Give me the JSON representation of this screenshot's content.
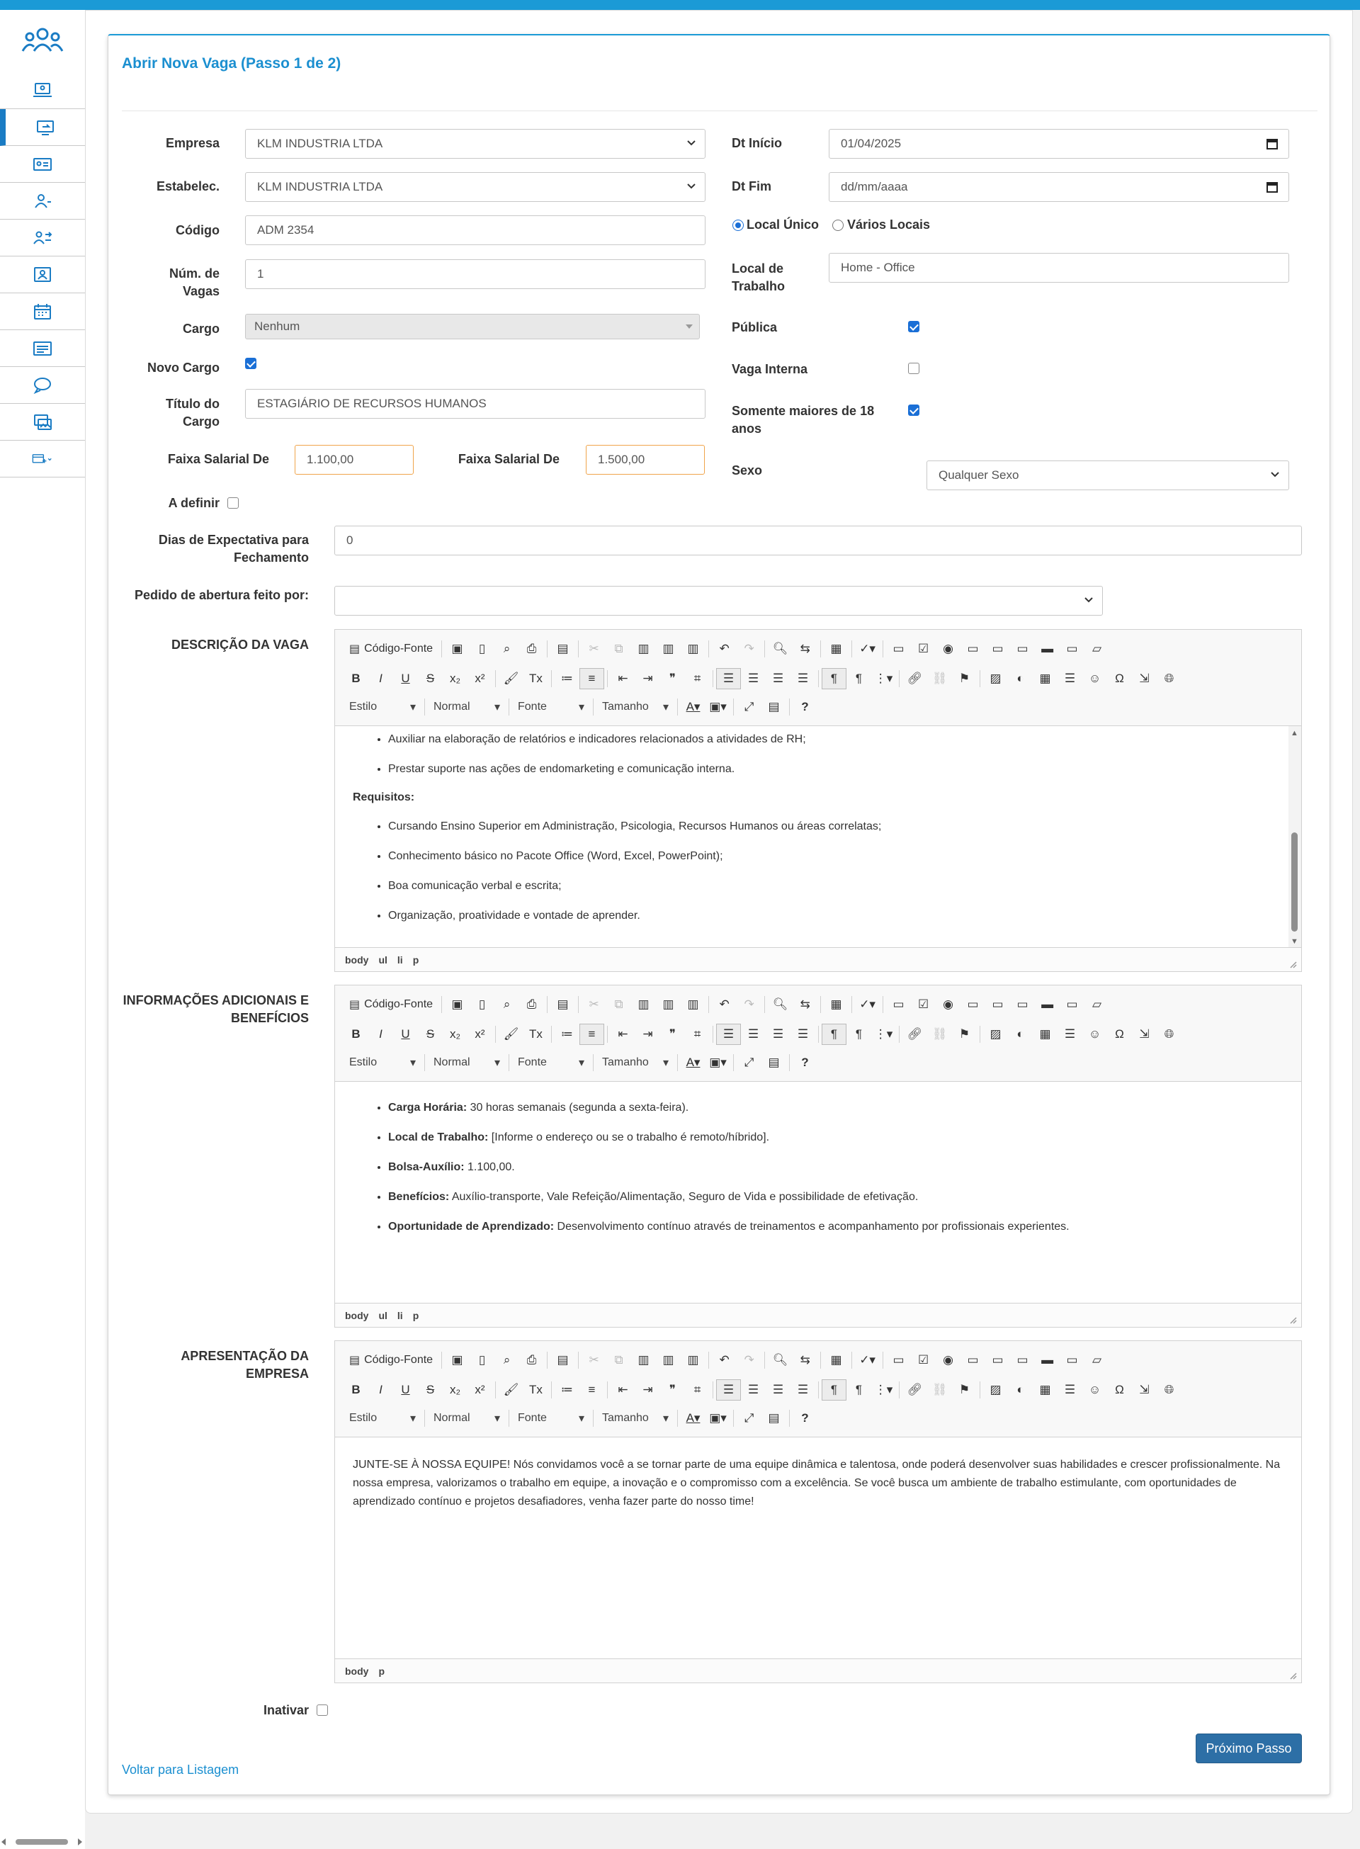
{
  "page": {
    "title": "Abrir Nova Vaga (Passo 1 de 2)"
  },
  "sidebar": {
    "items": [
      {
        "icon": "laptop-user-icon"
      },
      {
        "icon": "monitor-arrow-icon"
      },
      {
        "icon": "id-card-icon"
      },
      {
        "icon": "user-list-icon"
      },
      {
        "icon": "user-swap-icon"
      },
      {
        "icon": "user-frame-icon"
      },
      {
        "icon": "calendar-icon"
      },
      {
        "icon": "list-card-icon"
      },
      {
        "icon": "chat-icon"
      },
      {
        "icon": "image-swap-icon"
      },
      {
        "icon": "card-add-icon"
      }
    ]
  },
  "form": {
    "empresa": {
      "label": "Empresa",
      "value": "KLM INDUSTRIA LTDA"
    },
    "estabelec": {
      "label": "Estabelec.",
      "value": "KLM INDUSTRIA LTDA"
    },
    "codigo": {
      "label": "Código",
      "value": "ADM 2354"
    },
    "num_vagas": {
      "label": "Núm. de Vagas",
      "value": "1"
    },
    "cargo": {
      "label": "Cargo",
      "value": "Nenhum"
    },
    "novo_cargo": {
      "label": "Novo Cargo",
      "checked": true
    },
    "titulo_cargo": {
      "label": "Título do Cargo",
      "value": "ESTAGIÁRIO DE RECURSOS HUMANOS"
    },
    "faixa_de": {
      "label": "Faixa Salarial De",
      "value": "1.100,00"
    },
    "faixa_ate": {
      "label": "Faixa Salarial De",
      "value": "1.500,00"
    },
    "a_definir": {
      "label": "A definir",
      "checked": false
    },
    "dt_inicio": {
      "label": "Dt Início",
      "value": "01/04/2025"
    },
    "dt_fim": {
      "label": "Dt Fim",
      "value": "dd/mm/aaaa"
    },
    "local_unico": {
      "label": "Local Único",
      "checked": true
    },
    "varios_locais": {
      "label": "Vários Locais",
      "checked": false
    },
    "local_trabalho": {
      "label": "Local de Trabalho",
      "value": "Home - Office"
    },
    "publica": {
      "label": "Pública",
      "checked": true
    },
    "vaga_interna": {
      "label": "Vaga Interna",
      "checked": false
    },
    "maiores_18": {
      "label": "Somente maiores de 18 anos",
      "checked": true
    },
    "sexo": {
      "label": "Sexo",
      "value": "Qualquer Sexo"
    },
    "dias_expectativa": {
      "label": "Dias de Expectativa para Fechamento",
      "value": "0"
    },
    "pedido_abertura": {
      "label": "Pedido de abertura feito por:",
      "value": ""
    },
    "inativar": {
      "label": "Inativar",
      "checked": false
    }
  },
  "editor_toolbar": {
    "source_label": "Código-Fonte",
    "style_combo": "Estilo",
    "format_combo": "Normal",
    "font_combo": "Fonte",
    "size_combo": "Tamanho"
  },
  "descricao": {
    "label": "DESCRIÇÃO DA VAGA",
    "items_top": [
      "Auxiliar na elaboração de relatórios e indicadores relacionados a atividades de RH;",
      "Prestar suporte nas ações de endomarketing e comunicação interna."
    ],
    "requisitos_heading": "Requisitos:",
    "requisitos": [
      "Cursando Ensino Superior em Administração, Psicologia, Recursos Humanos ou áreas correlatas;",
      "Conhecimento básico no Pacote Office (Word, Excel, PowerPoint);",
      "Boa comunicação verbal e escrita;",
      "Organização, proatividade e vontade de aprender."
    ],
    "path": [
      "body",
      "ul",
      "li",
      "p"
    ]
  },
  "info": {
    "label": "INFORMAÇÕES ADICIONAIS E BENEFÍCIOS",
    "items": [
      {
        "bold": "Carga Horária:",
        "text": " 30 horas semanais (segunda a sexta-feira)."
      },
      {
        "bold": "Local de Trabalho:",
        "text": " [Informe o endereço ou se o trabalho é remoto/híbrido]."
      },
      {
        "bold": "Bolsa-Auxílio:",
        "text": " 1.100,00."
      },
      {
        "bold": "Benefícios:",
        "text": " Auxílio-transporte, Vale Refeição/Alimentação, Seguro de Vida e possibilidade de efetivação."
      },
      {
        "bold": "Oportunidade de Aprendizado:",
        "text": " Desenvolvimento contínuo através de treinamentos e acompanhamento por profissionais experientes."
      }
    ],
    "path": [
      "body",
      "ul",
      "li",
      "p"
    ]
  },
  "apresentacao": {
    "label": "APRESENTAÇÃO DA EMPRESA",
    "text": "JUNTE-SE À NOSSA EQUIPE! Nós convidamos você a se tornar parte de uma equipe dinâmica e talentosa, onde poderá desenvolver suas habilidades e crescer profissionalmente. Na nossa empresa, valorizamos o trabalho em equipe, a inovação e o compromisso com a excelência. Se você busca um ambiente de trabalho estimulante, com oportunidades de aprendizado contínuo e projetos desafiadores, venha fazer parte do nosso time!",
    "path": [
      "body",
      "p"
    ]
  },
  "actions": {
    "next_button": "Próximo Passo",
    "back_link": "Voltar para Listagem"
  },
  "colors": {
    "accent": "#1b9ad6",
    "link": "#1b8fd0",
    "primary_button": "#2d6fa6",
    "checkbox": "#1a6fd6"
  }
}
